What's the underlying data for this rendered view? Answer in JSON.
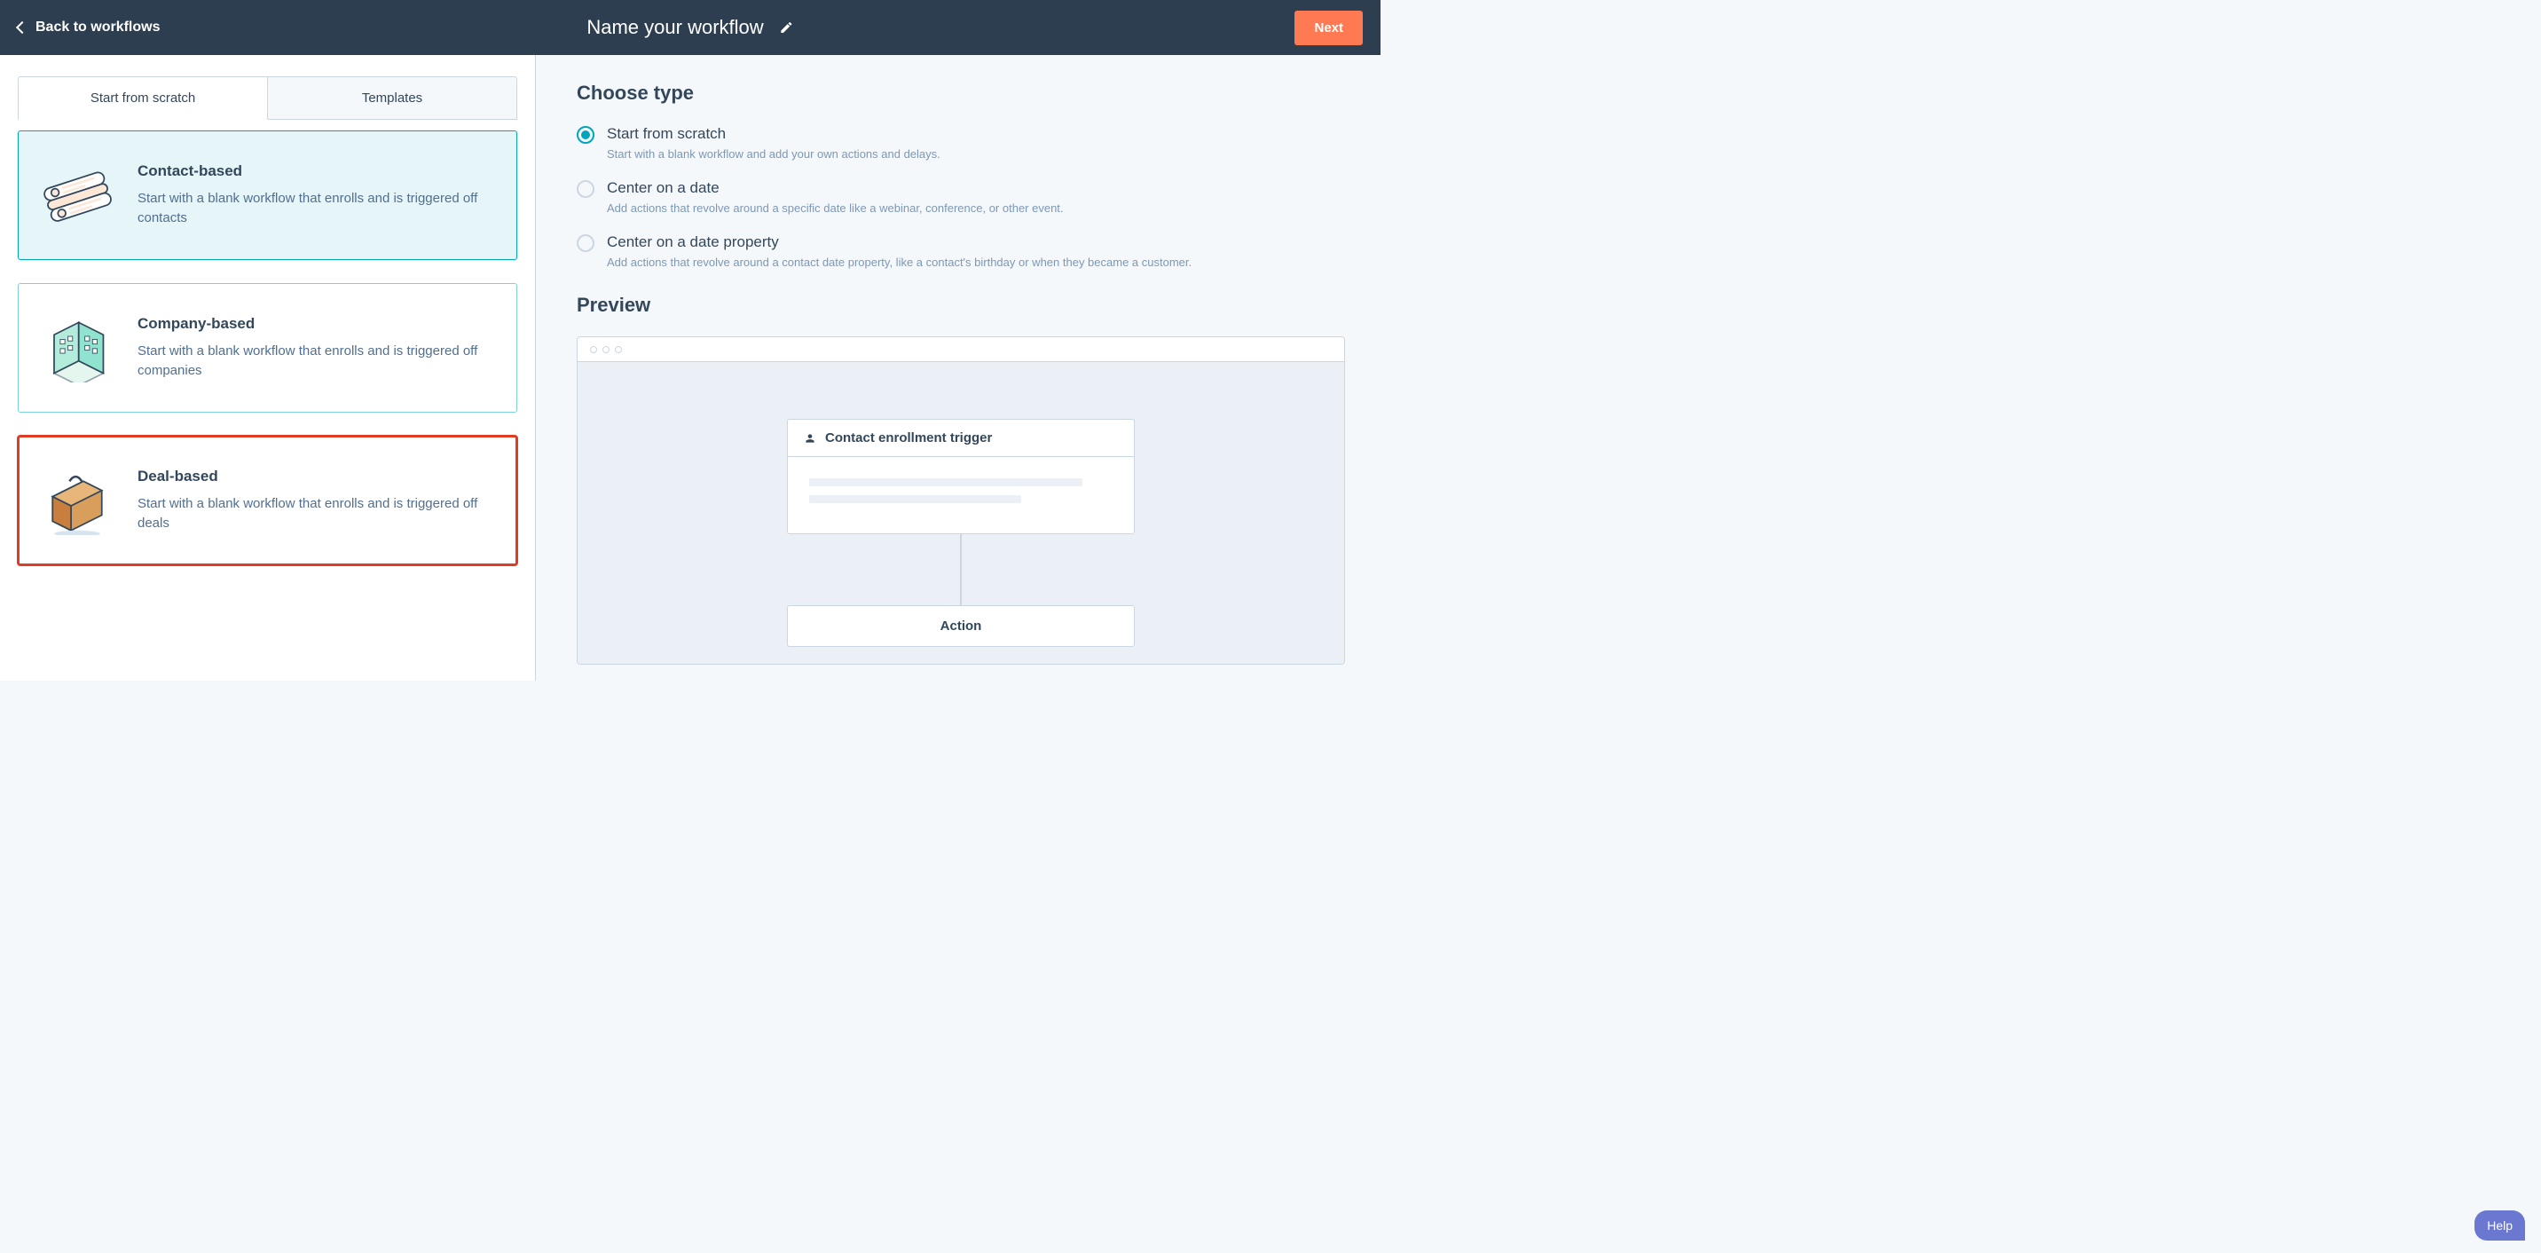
{
  "header": {
    "back_label": "Back to workflows",
    "title": "Name your workflow",
    "next_label": "Next"
  },
  "tabs": {
    "scratch": "Start from scratch",
    "templates": "Templates"
  },
  "cards": [
    {
      "title": "Contact-based",
      "desc": "Start with a blank workflow that enrolls and is triggered off contacts"
    },
    {
      "title": "Company-based",
      "desc": "Start with a blank workflow that enrolls and is triggered off companies"
    },
    {
      "title": "Deal-based",
      "desc": "Start with a blank workflow that enrolls and is triggered off deals"
    }
  ],
  "right": {
    "choose_type": "Choose type",
    "options": [
      {
        "label": "Start from scratch",
        "desc": "Start with a blank workflow and add your own actions and delays."
      },
      {
        "label": "Center on a date",
        "desc": "Add actions that revolve around a specific date like a webinar, conference, or other event."
      },
      {
        "label": "Center on a date property",
        "desc": "Add actions that revolve around a contact date property, like a contact's birthday or when they became a customer."
      }
    ],
    "preview_heading": "Preview",
    "trigger_label": "Contact enrollment trigger",
    "action_label": "Action"
  },
  "help": "Help"
}
